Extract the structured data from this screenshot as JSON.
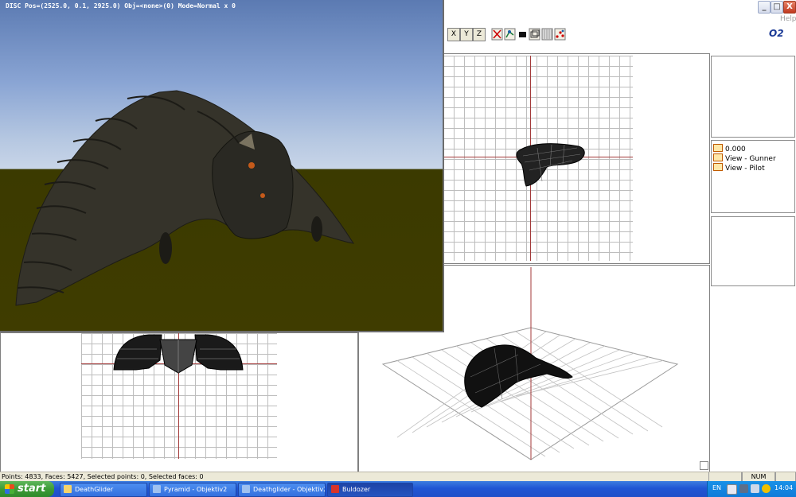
{
  "window": {
    "help_menu": "Help",
    "controls": {
      "minimize": "_",
      "maximize": "□",
      "close": "X"
    }
  },
  "toolbar": {
    "x_label": "X",
    "y_label": "Y",
    "z_label": "Z",
    "icons": [
      "selection-cross-icon",
      "move-points-icon",
      "solid-fill-icon",
      "faces-icon",
      "grid-toggle-icon",
      "scatter-points-icon"
    ],
    "logo": "O2"
  },
  "render_window": {
    "hud_text": "DISC Pos=(2525.0, 0.1, 2925.0) Obj=<none>(0) Mode=Normal x 0"
  },
  "panels": {
    "lod_list": [
      {
        "label": "0.000"
      },
      {
        "label": "View - Gunner"
      },
      {
        "label": "View - Pilot"
      }
    ]
  },
  "status_bar": {
    "text": "Points: 4833, Faces: 5427, Selected points: 0, Selected faces: 0",
    "num_indicator": "NUM"
  },
  "taskbar": {
    "start_label": "start",
    "tasks": [
      {
        "label": "DeathGlider",
        "icon": "folder-icon",
        "color": "#f5d36b"
      },
      {
        "label": "Pyramid - Objektiv2",
        "icon": "objektiv-icon",
        "color": "#9fc1f0"
      },
      {
        "label": "Deathglider - Objektiv2",
        "icon": "objektiv-icon",
        "color": "#9fc1f0"
      },
      {
        "label": "Buldozer",
        "icon": "buldozer-icon",
        "color": "#d8342a"
      }
    ],
    "tray": {
      "language": "EN",
      "clock": "14:04"
    }
  },
  "colors": {
    "axis": "#a33a3a",
    "grid": "#bdbdbd",
    "taskbar": "#2056d4",
    "start_button": "#3d9b36"
  }
}
